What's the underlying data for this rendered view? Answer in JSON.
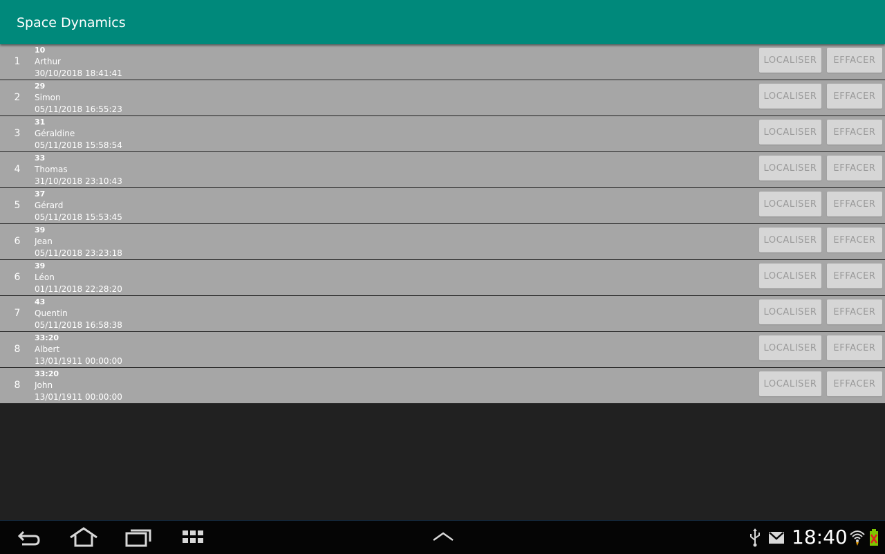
{
  "app": {
    "title": "Space Dynamics"
  },
  "buttons": {
    "locate": "LOCALISER",
    "delete": "EFFACER"
  },
  "rows": [
    {
      "rank": "1",
      "score": "10",
      "name": "Arthur",
      "date": "30/10/2018 18:41:41"
    },
    {
      "rank": "2",
      "score": "29",
      "name": "Simon",
      "date": "05/11/2018 16:55:23"
    },
    {
      "rank": "3",
      "score": "31",
      "name": "Géraldine",
      "date": "05/11/2018 15:58:54"
    },
    {
      "rank": "4",
      "score": "33",
      "name": "Thomas",
      "date": "31/10/2018 23:10:43"
    },
    {
      "rank": "5",
      "score": "37",
      "name": "Gérard",
      "date": "05/11/2018 15:53:45"
    },
    {
      "rank": "6",
      "score": "39",
      "name": "Jean",
      "date": "05/11/2018 23:23:18"
    },
    {
      "rank": "6",
      "score": "39",
      "name": "Léon",
      "date": "01/11/2018 22:28:20"
    },
    {
      "rank": "7",
      "score": "43",
      "name": "Quentin",
      "date": "05/11/2018 16:58:38"
    },
    {
      "rank": "8",
      "score": "33:20",
      "name": "Albert",
      "date": "13/01/1911 00:00:00"
    },
    {
      "rank": "8",
      "score": "33:20",
      "name": "John",
      "date": "13/01/1911 00:00:00"
    }
  ],
  "system_bar": {
    "time": "18:40",
    "icons": [
      "back-icon",
      "home-icon",
      "recent-apps-icon",
      "apps-grid-icon",
      "chevron-up-icon",
      "usb-icon",
      "gmail-icon",
      "wifi-icon",
      "battery-icon"
    ]
  },
  "colors": {
    "primary": "#00897b",
    "row_bg": "#a6a6a6",
    "button_bg": "#d6d6d6",
    "background": "#212121"
  }
}
